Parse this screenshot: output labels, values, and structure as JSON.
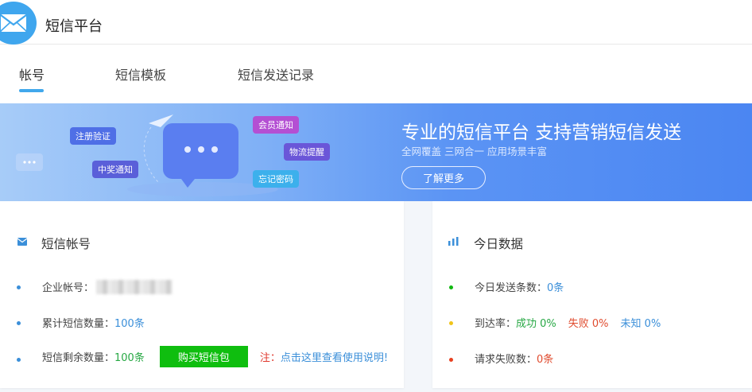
{
  "header": {
    "title": "短信平台",
    "icon": "envelope-icon"
  },
  "tabs": [
    {
      "label": "帐号",
      "active": true
    },
    {
      "label": "短信模板",
      "active": false
    },
    {
      "label": "短信发送记录",
      "active": false
    }
  ],
  "banner": {
    "headline": "专业的短信平台  支持营销短信发送",
    "subtitle": "全网覆盖   三网合一   应用场景丰富",
    "button": "了解更多",
    "bubbles": [
      "注册验证",
      "中奖通知",
      "会员通知",
      "物流提醒",
      "忘记密码"
    ]
  },
  "account": {
    "title": "短信帐号",
    "enterprise_label": "企业帐号：",
    "total_label": "累计短信数量：",
    "total_value": "100条",
    "remaining_label": "短信剩余数量：",
    "remaining_value": "100条",
    "buy_button": "购买短信包",
    "note_label": "注：",
    "note_link": "点击这里查看使用说明!"
  },
  "today": {
    "title": "今日数据",
    "sent_label": "今日发送条数：",
    "sent_value": "0条",
    "rate_label": "到达率：",
    "success": "成功 0%",
    "fail": "失败 0%",
    "unknown": "未知 0%",
    "failed_requests_label": "请求失败数：",
    "failed_requests_value": "0条"
  },
  "colors": {
    "accent": "#41a8ec",
    "buy_button": "#0fbe0f",
    "success": "#27a844",
    "fail": "#e04c2f",
    "unknown": "#3b8fd9"
  }
}
